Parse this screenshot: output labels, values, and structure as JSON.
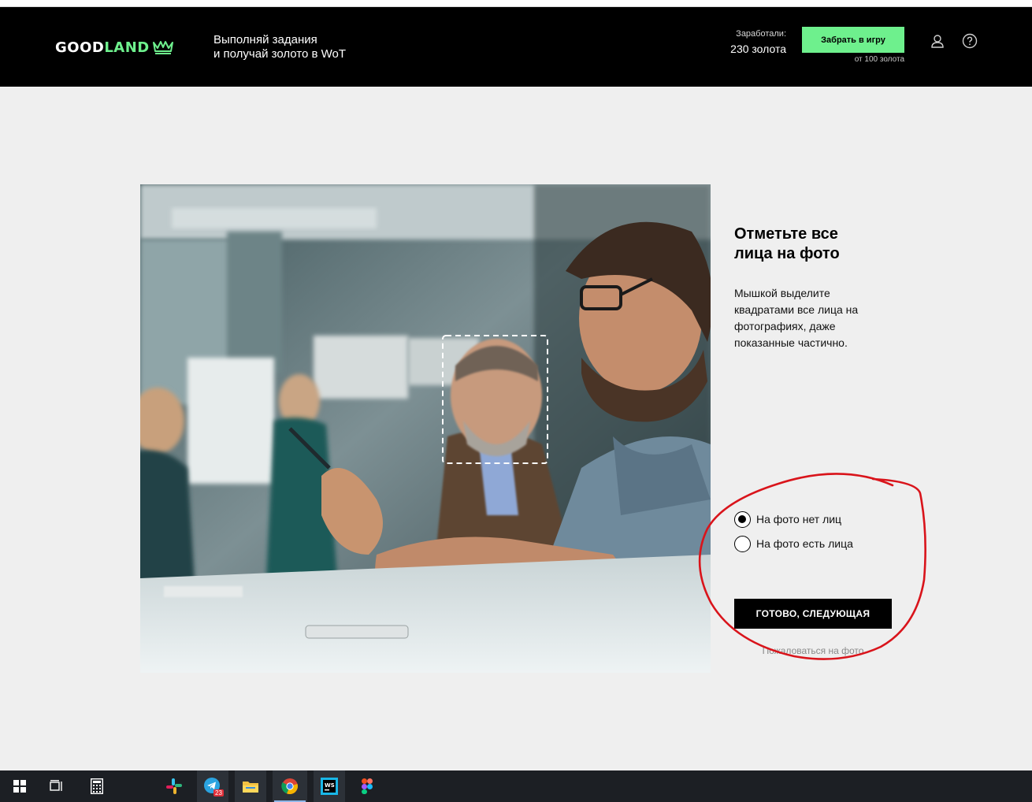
{
  "header": {
    "logo": {
      "word1": "GOOD",
      "word2": "LAND",
      "icon": "crown-icon"
    },
    "tagline_line1": "Выполняй задания",
    "tagline_line2": "и получай золото в WoT",
    "earned_label": "Заработали:",
    "earned_value": "230 золота",
    "claim_button": "Забрать в игру",
    "claim_note": "от 100 золота",
    "icons": [
      "user-icon",
      "help-icon"
    ]
  },
  "task": {
    "title_line1": "Отметьте все",
    "title_line2": "лица на фото",
    "description": "Мышкой выделите квадратами все лица на фотографиях, даже показанные частично.",
    "options": [
      {
        "label": "На фото нет лиц",
        "checked": true
      },
      {
        "label": "На фото есть лица",
        "checked": false
      }
    ],
    "submit_button": "ГОТОВО, СЛЕДУЮЩАЯ",
    "report_link": "Пожаловаться на фото"
  },
  "taskbar": {
    "items": [
      "windows-start-icon",
      "task-view-icon",
      "calculator-icon",
      "slack-icon",
      "telegram-icon",
      "file-explorer-icon",
      "chrome-icon",
      "webstorm-icon",
      "figma-icon"
    ],
    "telegram_badge": "23"
  },
  "colors": {
    "accent_green": "#6ef08d",
    "header_bg": "#000000",
    "page_bg": "#efefef",
    "annotation_red": "#d9141b"
  }
}
